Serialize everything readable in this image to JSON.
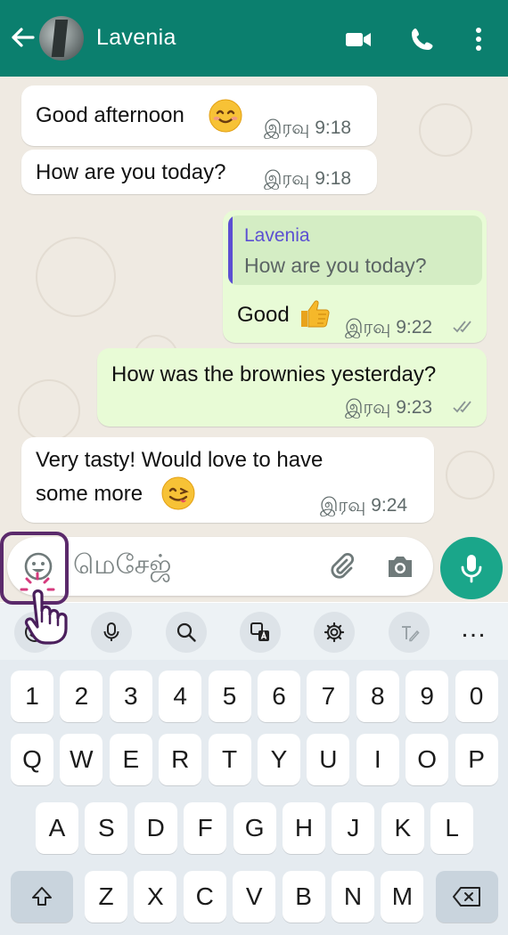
{
  "header": {
    "contact_name": "Lavenia",
    "back_icon": "arrow-left-icon",
    "video_icon": "video-call-icon",
    "call_icon": "phone-icon",
    "menu_icon": "more-vertical-icon",
    "color": "#0b7f6e"
  },
  "messages": [
    {
      "direction": "incoming",
      "text": "Good afternoon",
      "emoji": "smiling-face-icon",
      "time": "இரவு 9:18"
    },
    {
      "direction": "incoming",
      "text": "How are you today?",
      "time": "இரவு 9:18"
    },
    {
      "direction": "outgoing",
      "quote_author": "Lavenia",
      "quote_text": "How are you today?",
      "text": "Good",
      "emoji": "thumbs-up-icon",
      "time": "இரவு 9:22",
      "status": "read"
    },
    {
      "direction": "outgoing",
      "text": "How was the brownies yesterday?",
      "time": "இரவு 9:23",
      "status": "read"
    },
    {
      "direction": "incoming",
      "text_line1": "Very tasty! Would love to have",
      "text_line2": "some more",
      "emoji": "yum-face-icon",
      "time": "இரவு 9:24"
    }
  ],
  "composer": {
    "placeholder": "மெசேஜ்",
    "emoji_icon": "emoji-icon",
    "attach_icon": "paperclip-icon",
    "camera_icon": "camera-icon",
    "mic_icon": "mic-icon",
    "accent": "#1aa68a"
  },
  "keyboard": {
    "toolbar_icons": [
      "emoji-icon",
      "mic-icon",
      "search-icon",
      "translate-icon",
      "settings-icon",
      "handwriting-icon",
      "more-icon"
    ],
    "more_label": "…",
    "row_numbers": [
      "1",
      "2",
      "3",
      "4",
      "5",
      "6",
      "7",
      "8",
      "9",
      "0"
    ],
    "row_top": [
      "Q",
      "W",
      "E",
      "R",
      "T",
      "Y",
      "U",
      "I",
      "O",
      "P"
    ],
    "row_middle": [
      "A",
      "S",
      "D",
      "F",
      "G",
      "H",
      "J",
      "K",
      "L"
    ],
    "row_bottom": [
      "Z",
      "X",
      "C",
      "V",
      "B",
      "N",
      "M"
    ],
    "shift_icon": "shift-icon",
    "backspace_icon": "backspace-icon"
  },
  "overlay": {
    "pointer_icon": "tap-hand-icon",
    "highlight_color": "#5b2a6b"
  }
}
